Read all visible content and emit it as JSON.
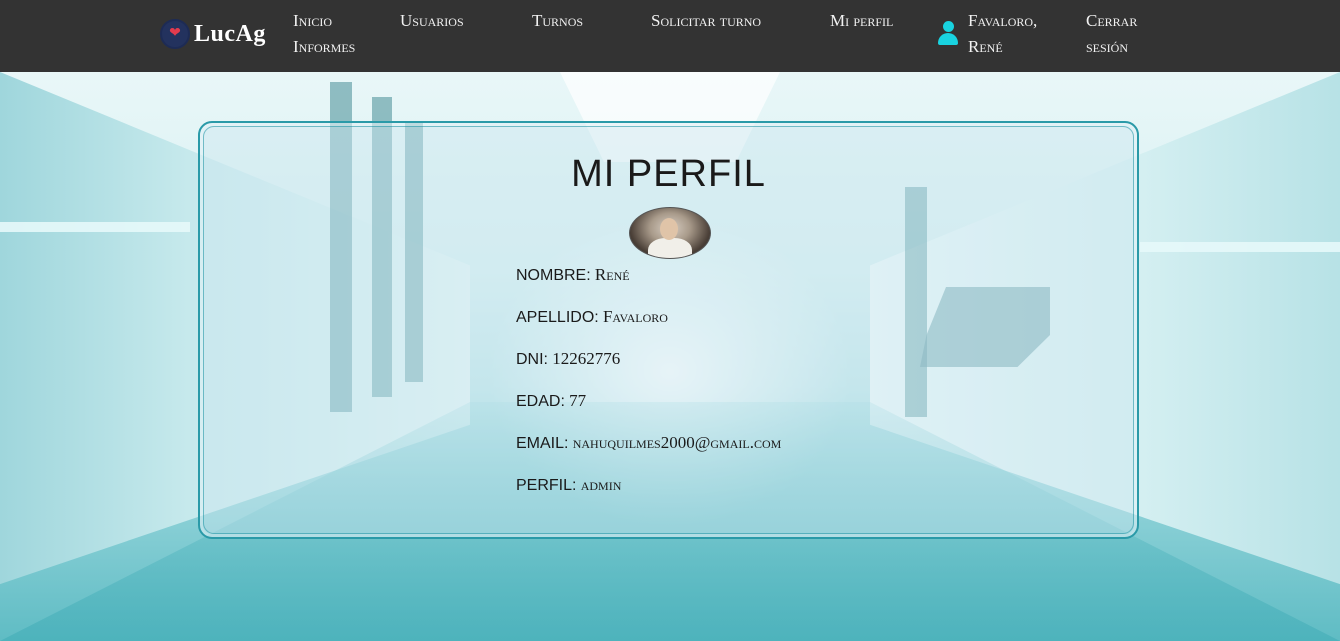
{
  "navbar": {
    "brand": "LucAg",
    "links": {
      "inicio": "Inicio",
      "informes": "Informes",
      "usuarios": "Usuarios",
      "turnos": "Turnos",
      "solicitar_turno": "Solicitar turno",
      "mi_perfil": "Mi perfil"
    },
    "user": {
      "name_line1": "Favaloro,",
      "name_line2": "René",
      "icon": "user-icon",
      "icon_color": "#19d3e0"
    },
    "logout_line1": "Cerrar",
    "logout_line2": "sesión",
    "background_color": "#333333"
  },
  "profile": {
    "title": "MI PERFIL",
    "fields": [
      {
        "label": "NOMBRE:",
        "value": "René"
      },
      {
        "label": "APELLIDO:",
        "value": "Favaloro"
      },
      {
        "label": "DNI:",
        "value": "12262776"
      },
      {
        "label": "EDAD:",
        "value": "77"
      },
      {
        "label": "EMAIL:",
        "value": "nahuquilmes2000@gmail.com"
      },
      {
        "label": "PERFIL:",
        "value": "admin"
      }
    ],
    "border_color": "#2a9aa8"
  }
}
